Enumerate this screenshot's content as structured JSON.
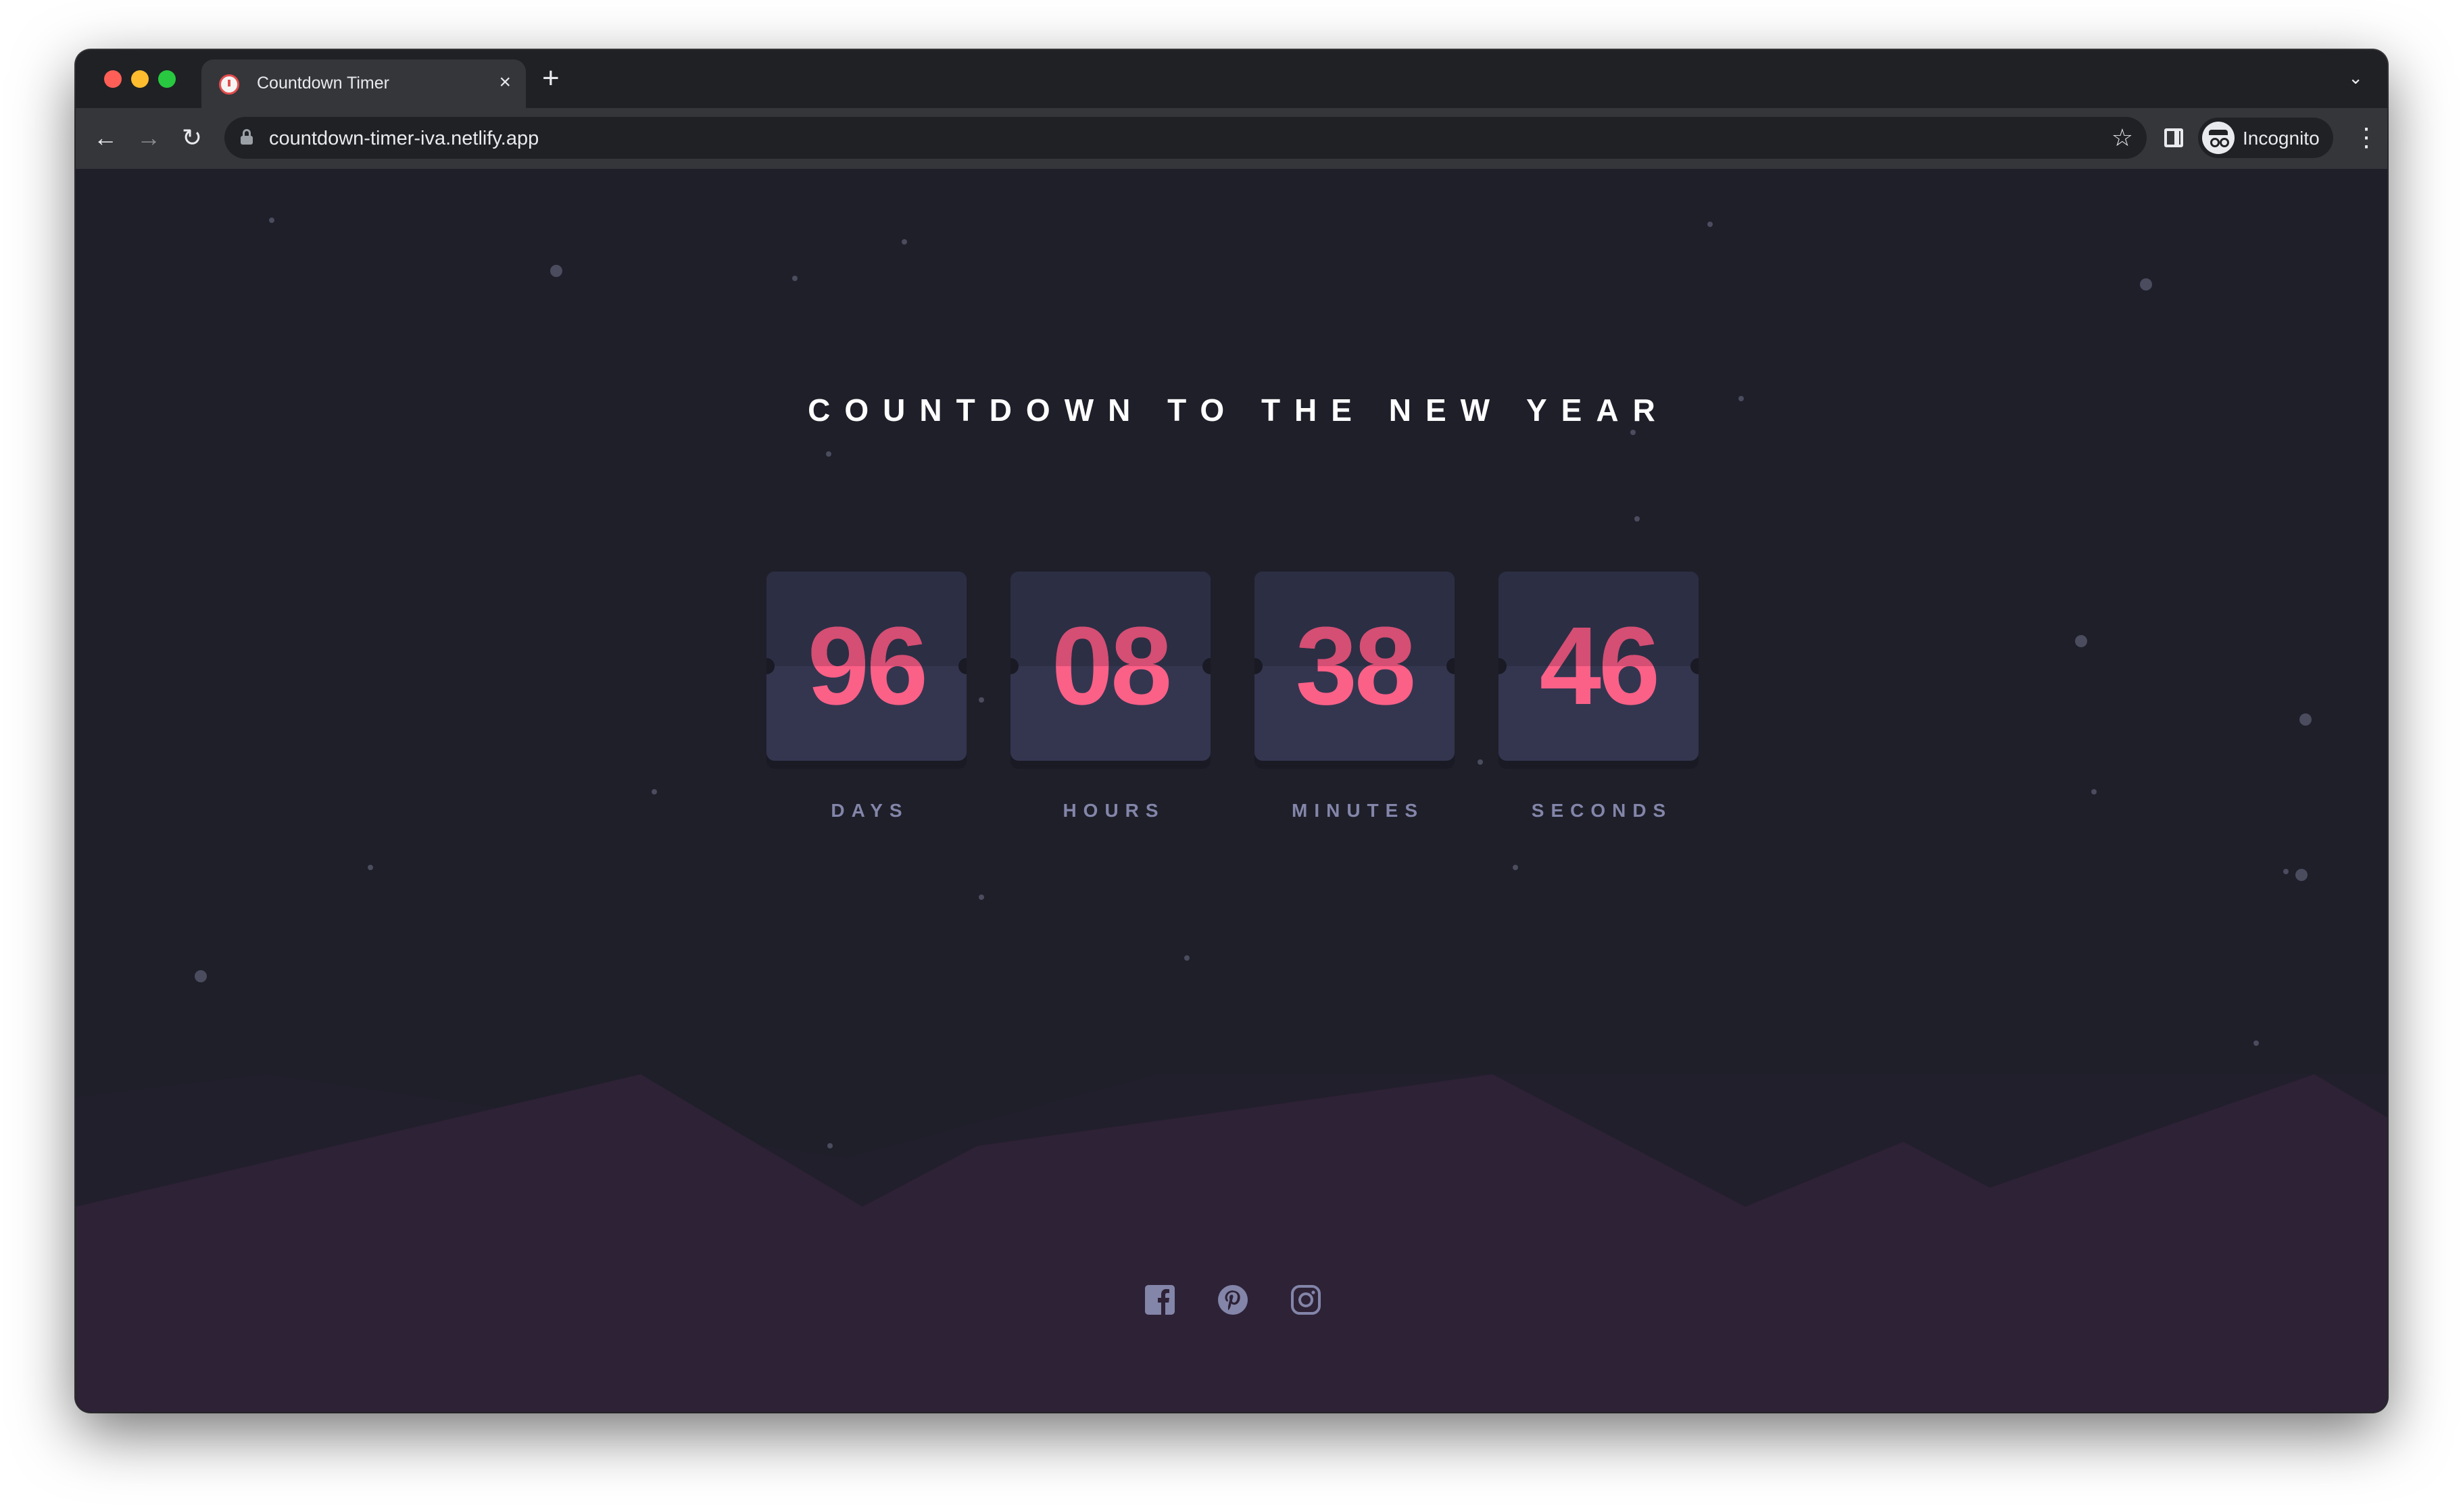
{
  "browser": {
    "tab": {
      "title": "Countdown Timer",
      "close_icon": "×",
      "favicon": "countdown-timer-icon"
    },
    "new_tab_icon": "+",
    "tab_menu_icon": "⌄",
    "url": "countdown-timer-iva.netlify.app",
    "profile_label": "Incognito",
    "icons": [
      "back-arrow-icon",
      "forward-arrow-icon",
      "reload-icon",
      "lock-icon",
      "star-icon",
      "side-panel-icon",
      "incognito-icon",
      "menu-kebab-icon"
    ]
  },
  "page": {
    "heading": "COUNTDOWN TO THE NEW YEAR",
    "timer": [
      {
        "value": "96",
        "label": "DAYS"
      },
      {
        "value": "08",
        "label": "HOURS"
      },
      {
        "value": "38",
        "label": "MINUTES"
      },
      {
        "value": "46",
        "label": "SECONDS"
      }
    ],
    "social_links": [
      "facebook-icon",
      "pinterest-icon",
      "instagram-icon"
    ]
  },
  "colors": {
    "page_background": "#1e1f29",
    "card": "#343650",
    "digits": "#fb6087",
    "labels": "#8385a9",
    "hills": "#2e2236"
  }
}
